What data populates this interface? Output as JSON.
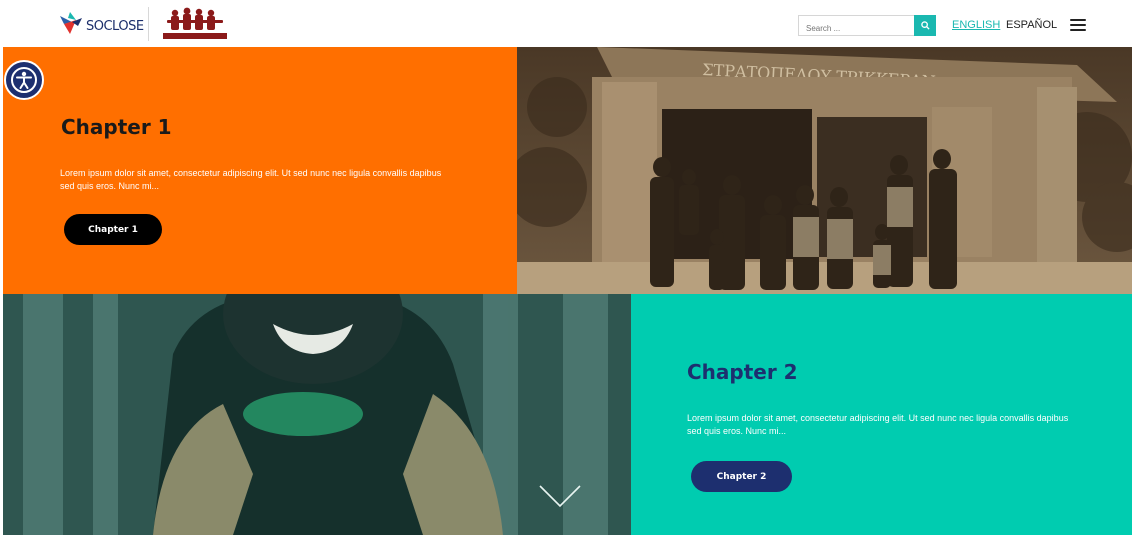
{
  "header": {
    "logo_text": "SOCLOSE",
    "search": {
      "placeholder": "Search ...",
      "icon": "search-icon"
    },
    "languages": [
      {
        "label": "ENGLISH",
        "active": true
      },
      {
        "label": "ESPAÑOL",
        "active": false
      }
    ],
    "menu_icon": "hamburger-icon"
  },
  "accessibility": {
    "icon": "accessibility-icon"
  },
  "chapters": [
    {
      "title": "Chapter 1",
      "text": "Lorem ipsum dolor sit amet, consectetur adipiscing elit. Ut sed nunc nec ligula convallis dapibus sed quis eros. Nunc mi...",
      "button_label": "Chapter 1",
      "photo_sign": "ΣΤΡΑΤΟΠΕΔΟΥ ΤΡΙΚΚΕΡΑΝ"
    },
    {
      "title": "Chapter 2",
      "text": "Lorem ipsum dolor sit amet, consectetur adipiscing elit. Ut sed nunc nec ligula convallis dapibus sed quis eros. Nunc mi...",
      "button_label": "Chapter 2",
      "scroll_icon": "chevron-down-icon"
    }
  ],
  "colors": {
    "orange": "#ff6f00",
    "teal": "#00ccb0",
    "navy": "#1d2f6f",
    "accent": "#1ab8b0",
    "black": "#000000"
  }
}
